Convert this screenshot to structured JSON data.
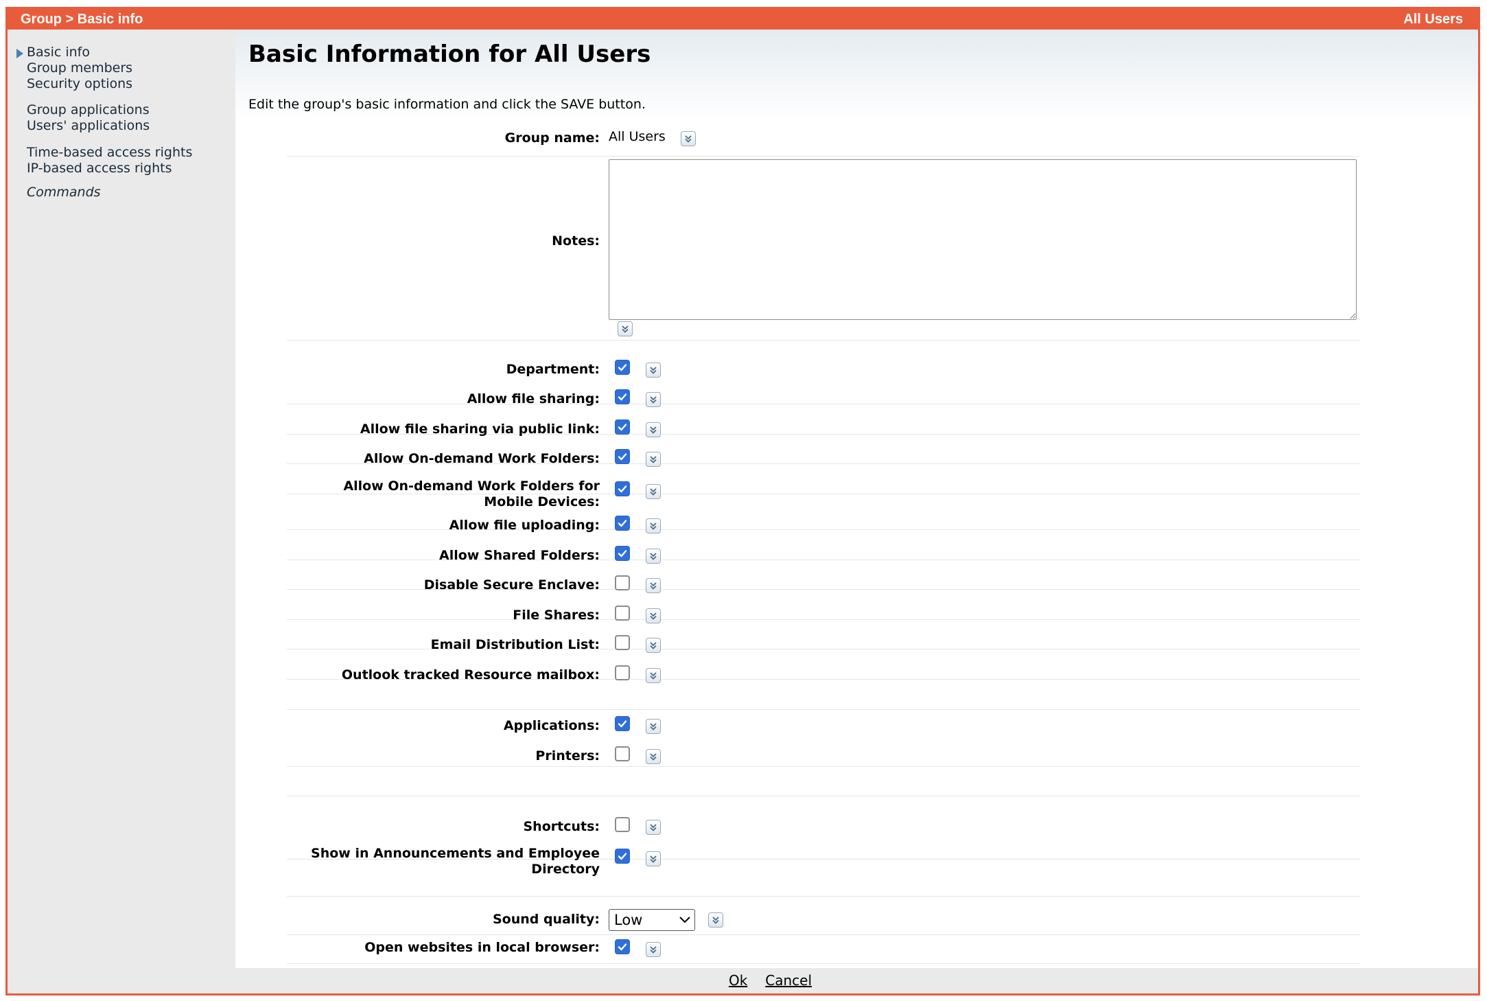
{
  "titlebar": {
    "breadcrumb": "Group > Basic info",
    "right_label": "All Users",
    "accent_color": "#e85c3c"
  },
  "sidebar": {
    "groups": [
      [
        "Basic info",
        "Group members",
        "Security options"
      ],
      [
        "Group applications",
        "Users' applications"
      ],
      [
        "Time-based access rights",
        "IP-based access rights"
      ],
      [
        "Commands"
      ]
    ],
    "selected": "Basic info"
  },
  "main": {
    "title": "Basic Information for All Users",
    "description": "Edit the group's basic information and click the SAVE button."
  },
  "form": {
    "group_name_label": "Group name:",
    "group_name_value": "All Users",
    "notes_label": "Notes:",
    "notes_value": "",
    "checkboxes": [
      {
        "label": "Department:",
        "checked": true
      },
      {
        "label": "Allow file sharing:",
        "checked": true
      },
      {
        "label": "Allow file sharing via public link:",
        "checked": true
      },
      {
        "label": "Allow On-demand Work Folders:",
        "checked": true
      },
      {
        "label": "Allow On-demand Work Folders for Mobile Devices:",
        "checked": true
      },
      {
        "label": "Allow file uploading:",
        "checked": true
      },
      {
        "label": "Allow Shared Folders:",
        "checked": true
      },
      {
        "label": "Disable Secure Enclave:",
        "checked": false
      },
      {
        "label": "File Shares:",
        "checked": false
      },
      {
        "label": "Email Distribution List:",
        "checked": false
      },
      {
        "label": "Outlook tracked Resource mailbox:",
        "checked": false
      },
      {
        "label": "Applications:",
        "checked": true
      },
      {
        "label": "Printers:",
        "checked": false
      },
      {
        "label": "Shortcuts:",
        "checked": false
      },
      {
        "label": "Show in Announcements and Employee Directory",
        "checked": true
      }
    ],
    "sound_quality_label": "Sound quality:",
    "sound_quality_value": "Low",
    "open_websites_label": "Open websites in local browser:",
    "open_websites_checked": true
  },
  "footer": {
    "ok_label": "Ok",
    "cancel_label": "Cancel"
  },
  "icons": {
    "expander": "double-chevron-down-icon",
    "checkmark": "checkmark-icon",
    "nav_selected": "triangle-right-icon"
  }
}
